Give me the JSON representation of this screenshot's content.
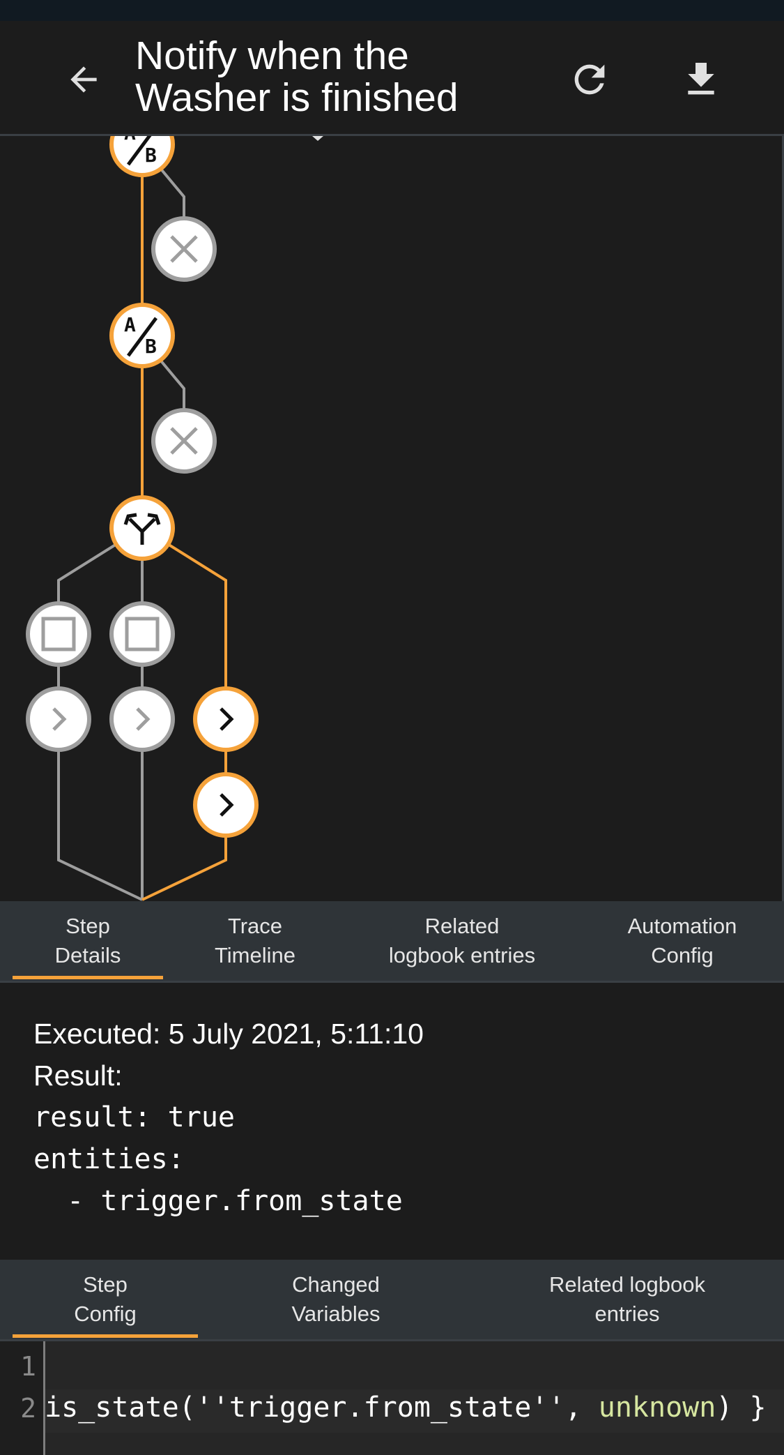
{
  "header": {
    "title": "Notify when the Washer is finished",
    "back_icon": "arrow-left-icon",
    "refresh_icon": "refresh-icon",
    "download_icon": "download-icon"
  },
  "graph": {
    "colors": {
      "active": "#f5a23a",
      "inactive": "#9e9e9e",
      "node_fill": "#ffffff"
    },
    "nodes": [
      {
        "id": "condition-1",
        "icon": "a-slash-b-icon",
        "state": "active"
      },
      {
        "id": "condition-1-fail",
        "icon": "close-icon",
        "state": "inactive"
      },
      {
        "id": "condition-2",
        "icon": "a-slash-b-icon",
        "state": "active"
      },
      {
        "id": "condition-2-fail",
        "icon": "close-icon",
        "state": "inactive"
      },
      {
        "id": "choose",
        "icon": "call-split-icon",
        "state": "active"
      },
      {
        "id": "option-1-condition",
        "icon": "square-icon",
        "state": "inactive"
      },
      {
        "id": "option-2-condition",
        "icon": "square-icon",
        "state": "inactive"
      },
      {
        "id": "option-1-action",
        "icon": "chevron-right-icon",
        "state": "inactive"
      },
      {
        "id": "option-2-action",
        "icon": "chevron-right-icon",
        "state": "inactive"
      },
      {
        "id": "default-action-1",
        "icon": "chevron-right-icon",
        "state": "active"
      },
      {
        "id": "default-action-2",
        "icon": "chevron-right-icon",
        "state": "active"
      }
    ]
  },
  "tabs_top": [
    {
      "label": "Step\nDetails",
      "active": true
    },
    {
      "label": "Trace\nTimeline",
      "active": false
    },
    {
      "label": "Related\nlogbook entries",
      "active": false
    },
    {
      "label": "Automation\nConfig",
      "active": false
    }
  ],
  "details": {
    "executed": "Executed: 5 July 2021, 5:11:10",
    "result_label": "Result:",
    "yaml_line_1": "result: true",
    "yaml_line_2": "entities:",
    "yaml_line_3": "  - trigger.from_state"
  },
  "tabs_bottom": [
    {
      "label": "Step\nConfig",
      "active": true
    },
    {
      "label": "Changed\nVariables",
      "active": false
    },
    {
      "label": "Related logbook\nentries",
      "active": false
    }
  ],
  "editor": {
    "line_numbers": [
      "1",
      "2"
    ],
    "line_1": "",
    "line_2_prefix": "is_state(",
    "line_2_string": "''trigger.from_state''",
    "line_2_mid": ", ",
    "line_2_arg": "unknown",
    "line_2_suffix": ") }",
    "colors": {
      "text": "#ffffff",
      "string": "#ffffff",
      "arg": "#d6e6a0"
    }
  }
}
